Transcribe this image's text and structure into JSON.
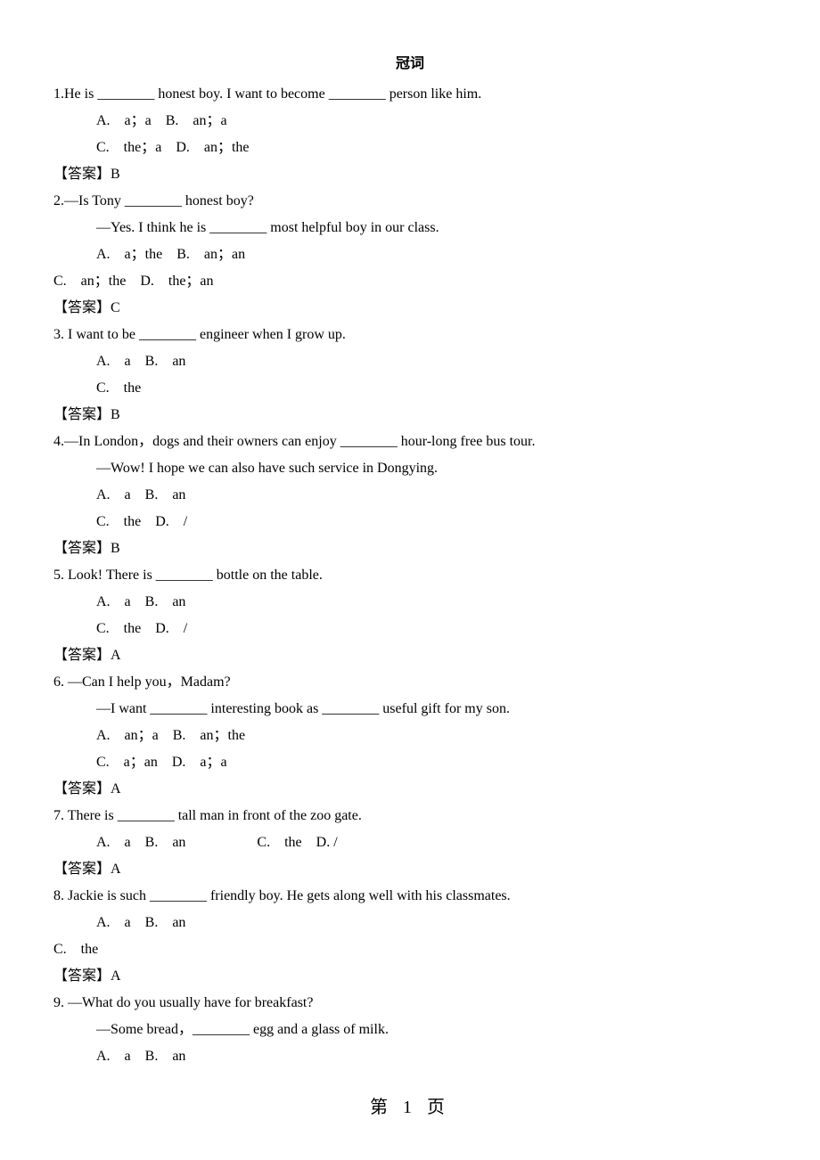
{
  "title": "冠词",
  "answer_label": "【答案】",
  "footer": "第 1 页",
  "questions": [
    {
      "num": "1",
      "lines": [
        {
          "cls": "",
          "text": "1.He is ________ honest boy. I want to become ________ person like him."
        },
        {
          "cls": "indent1",
          "text": "A.　a；a　B.　an；a"
        },
        {
          "cls": "indent1",
          "text": "C.　the；a　D.　an；the"
        }
      ],
      "answer": "B"
    },
    {
      "num": "2",
      "lines": [
        {
          "cls": "",
          "text": "2.—Is Tony ________ honest boy?"
        },
        {
          "cls": "indent-dialog",
          "text": "—Yes. I think he is ________ most helpful boy in our class."
        },
        {
          "cls": "indent1",
          "text": "A.　a；the　B.　an；an"
        },
        {
          "cls": "",
          "text": "C.　an；the　D.　the；an"
        }
      ],
      "answer": "C"
    },
    {
      "num": "3",
      "lines": [
        {
          "cls": "",
          "text": "3. I want to be ________ engineer when I grow up."
        },
        {
          "cls": "indent1",
          "text": "A.　a　B.　an"
        },
        {
          "cls": "indent1",
          "text": "C.　the"
        }
      ],
      "answer": "B"
    },
    {
      "num": "4",
      "lines": [
        {
          "cls": "",
          "text": "4.—In London，dogs and their owners can enjoy ________ hour-long free bus tour."
        },
        {
          "cls": "indent-dialog",
          "text": "—Wow! I hope we can also have such service in Dongying."
        },
        {
          "cls": "indent1",
          "text": "A.　a　B.　an"
        },
        {
          "cls": "indent1",
          "text": "C.　the　D.　/"
        }
      ],
      "answer": "B"
    },
    {
      "num": "5",
      "lines": [
        {
          "cls": "",
          "text": "5. Look! There is ________ bottle on the table."
        },
        {
          "cls": "indent1",
          "text": "A.　a　B.　an"
        },
        {
          "cls": "indent1",
          "text": "C.　the　D.　/"
        }
      ],
      "answer": "A"
    },
    {
      "num": "6",
      "lines": [
        {
          "cls": "",
          "text": "6. —Can I help you，Madam?"
        },
        {
          "cls": "indent-dialog",
          "text": "—I want ________ interesting book as ________ useful gift for my son."
        },
        {
          "cls": "indent1",
          "text": "A.　an；a　B.　an；the"
        },
        {
          "cls": "indent1",
          "text": "C.　a；an　D.　a；a"
        }
      ],
      "answer": "A"
    },
    {
      "num": "7",
      "lines": [
        {
          "cls": "",
          "text": "7. There is ________ tall man in front of the zoo gate."
        },
        {
          "cls": "indent1",
          "text": "A.　a　B.　an　　　　　C.　the　D. /"
        }
      ],
      "answer": "A"
    },
    {
      "num": "8",
      "lines": [
        {
          "cls": "",
          "text": "8. Jackie is such ________ friendly boy. He gets along well with his classmates."
        },
        {
          "cls": "indent1",
          "text": "A.　a　B.　an"
        },
        {
          "cls": "",
          "text": "C.　the"
        }
      ],
      "answer": "A"
    },
    {
      "num": "9",
      "lines": [
        {
          "cls": "",
          "text": "9. —What do you usually have for breakfast?"
        },
        {
          "cls": "indent-dialog",
          "text": "—Some bread，________ egg and a glass of milk."
        },
        {
          "cls": "indent1",
          "text": "A.　a　B.　an"
        }
      ],
      "answer": null
    }
  ]
}
